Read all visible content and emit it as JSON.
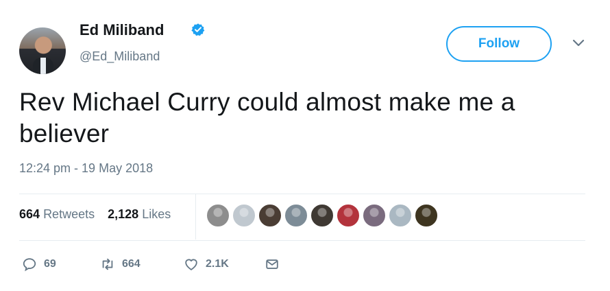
{
  "author": {
    "name": "Ed Miliband",
    "handle": "@Ed_Miliband",
    "verified": true
  },
  "follow_button": {
    "label": "Follow"
  },
  "tweet": {
    "text": "Rev Michael Curry could almost make me a believer",
    "timestamp": "12:24 pm - 19 May 2018"
  },
  "stats": {
    "retweets_count": "664",
    "retweets_label": "Retweets",
    "likes_count": "2,128",
    "likes_label": "Likes"
  },
  "likers": [
    {
      "color": "#8d8d8d"
    },
    {
      "color": "#c0c8cf"
    },
    {
      "color": "#4a3d34"
    },
    {
      "color": "#7d8c97"
    },
    {
      "color": "#3f3933"
    },
    {
      "color": "#b3333c"
    },
    {
      "color": "#7a6b7e"
    },
    {
      "color": "#aab8c2"
    },
    {
      "color": "#3e3520"
    }
  ],
  "actions": {
    "reply_count": "69",
    "retweet_count": "664",
    "like_count": "2.1K"
  },
  "colors": {
    "accent": "#1da1f2",
    "secondary_text": "#657786",
    "primary_text": "#14171a",
    "divider": "#e6ecf0"
  },
  "icons": [
    "verified-badge-icon",
    "chevron-down-icon",
    "reply-icon",
    "retweet-icon",
    "heart-icon",
    "message-icon"
  ]
}
